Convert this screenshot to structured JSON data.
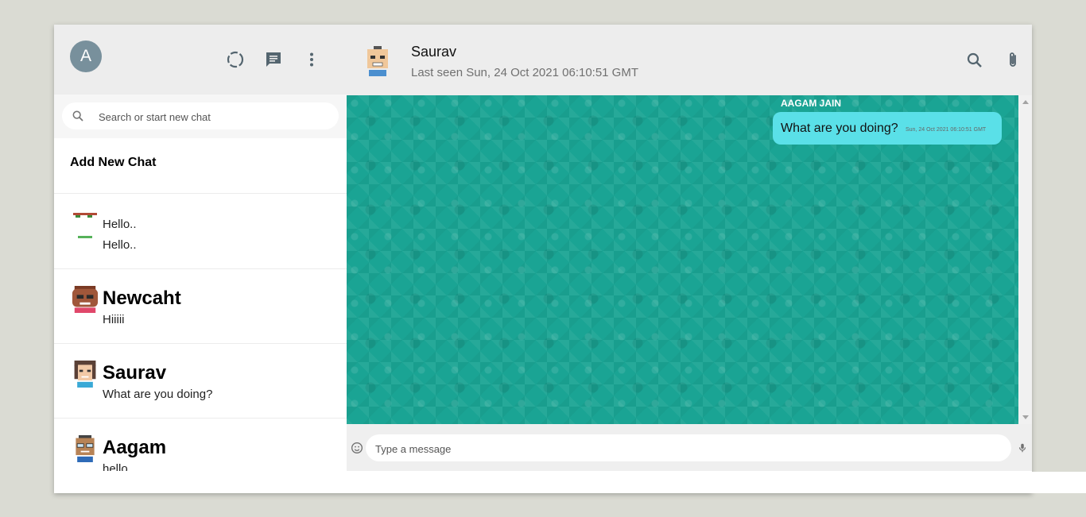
{
  "sidebar": {
    "profile_initial": "A",
    "icons": {
      "status": "status-icon",
      "new_chat": "chat-icon",
      "menu": "more-vert-icon"
    },
    "search_placeholder": "Search or start new chat",
    "add_new_chat": "Add New Chat",
    "chats": [
      {
        "name": "",
        "last_message": "Hello..",
        "avatar_alt": "Hello.."
      },
      {
        "name": "Newcaht",
        "last_message": "Hiiiii"
      },
      {
        "name": "Saurav",
        "last_message": "What are you doing?"
      },
      {
        "name": "Aagam",
        "last_message": "hello"
      }
    ]
  },
  "main": {
    "contact_name": "Saurav",
    "last_seen": "Last seen Sun, 24 Oct 2021 06:10:51 GMT",
    "icons": {
      "search": "search-icon",
      "attach": "attach-icon",
      "menu": "more-vert-icon"
    },
    "messages": [
      {
        "sender": "AAGAM JAIN",
        "text": "What are you doing?",
        "time": "Sun, 24 Oct 2021 06:10:51 GMT"
      }
    ],
    "composer_placeholder": "Type a message"
  },
  "colors": {
    "chat_background": "#1aa494",
    "bubble": "#5ae0e8",
    "header": "#ededed",
    "profile_avatar": "#78909c"
  }
}
